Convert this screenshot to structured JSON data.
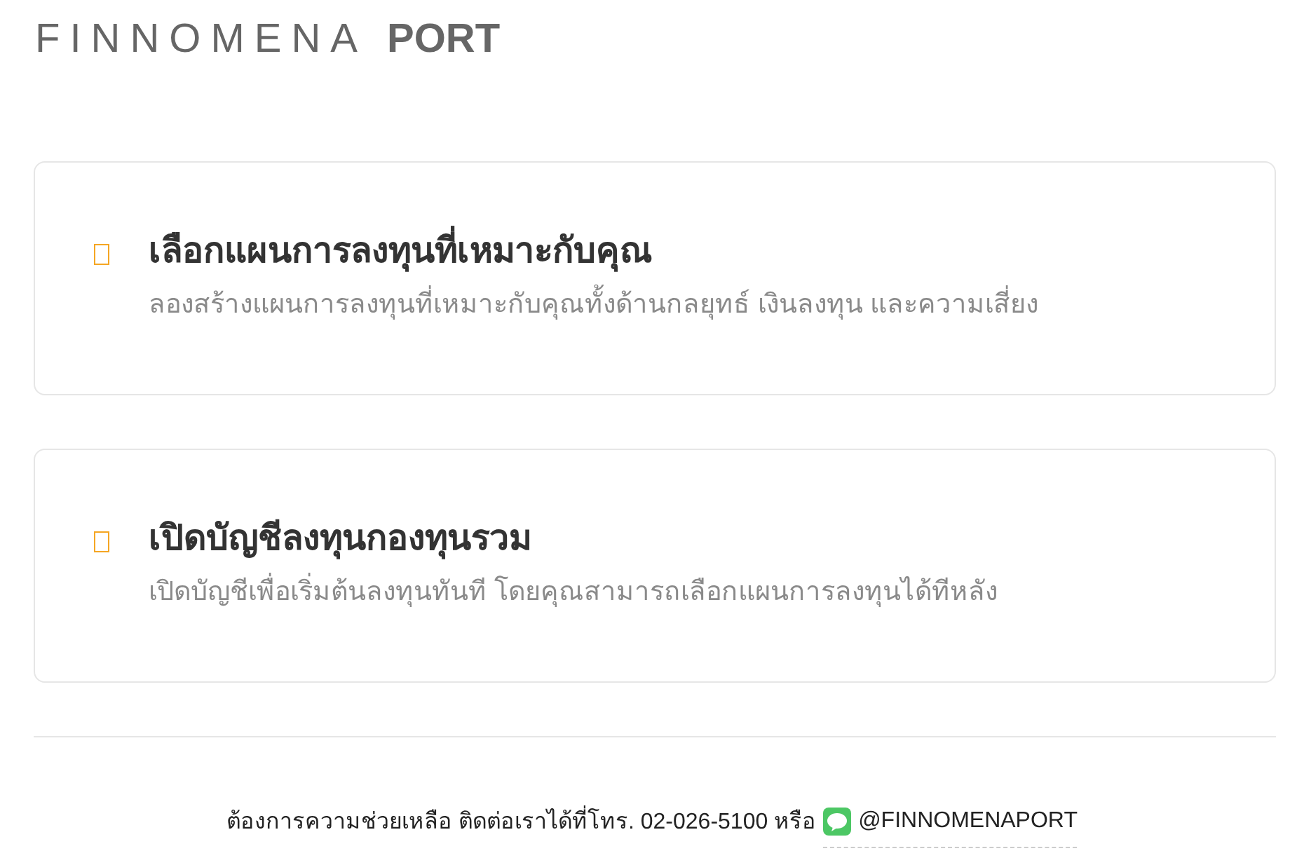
{
  "logo": {
    "brand": "FINNOMENA",
    "product": "PORT"
  },
  "options": [
    {
      "title": "เลือกแผนการลงทุนที่เหมาะกับคุณ",
      "description": "ลองสร้างแผนการลงทุนที่เหมาะกับคุณทั้งด้านกลยุทธ์ เงินลงทุน และความเสี่ยง"
    },
    {
      "title": "เปิดบัญชีลงทุนกองทุนรวม",
      "description": "เปิดบัญชีเพื่อเริ่มต้นลงทุนทันที โดยคุณสามารถเลือกแผนการลงทุนได้ทีหลัง"
    }
  ],
  "footer": {
    "text": "ต้องการความช่วยเหลือ ติดต่อเราได้ที่โทร. 02-026-5100 หรือ",
    "line_account": "@FINNOMENAPORT"
  }
}
